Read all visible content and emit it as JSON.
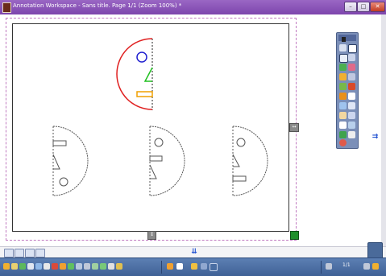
{
  "window": {
    "title": "Annotation Workspace - Sans title. Page 1/1 (Zoom 100%) *",
    "minimize_label": "–",
    "maximize_label": "□",
    "close_label": "✕"
  },
  "status": {
    "page_number": "1/1"
  },
  "colors": {
    "titlebar": "#8a55b8",
    "taskbar": "#4a6ea3",
    "palette": "#7b8fb8",
    "accent_blue": "#1e4fd0",
    "face_red": "#e02020",
    "face_blue": "#2020d0",
    "face_green": "#20c020",
    "face_orange": "#f0a000"
  },
  "icons": {
    "h_resize": "↔",
    "v_resize": "↕",
    "nav_right": "⇉",
    "nav_down": "⇊"
  }
}
